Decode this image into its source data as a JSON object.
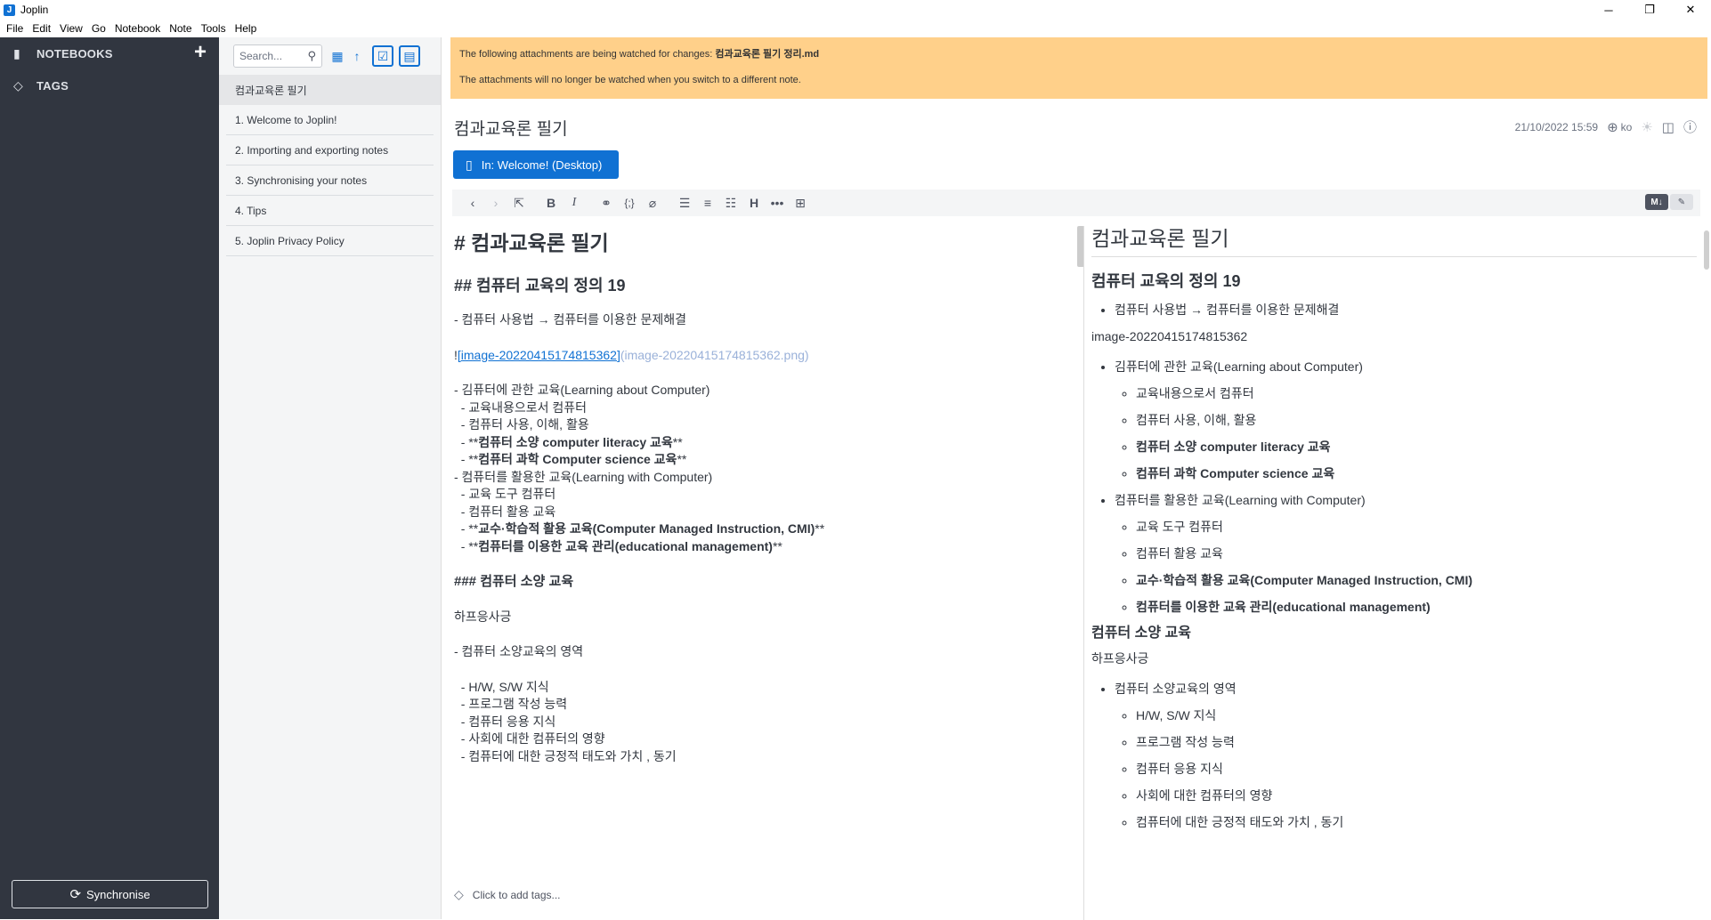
{
  "window": {
    "title": "Joplin",
    "minimize": "─",
    "maximize": "❐",
    "close": "✕"
  },
  "menu": [
    "File",
    "Edit",
    "View",
    "Go",
    "Notebook",
    "Note",
    "Tools",
    "Help"
  ],
  "sidebar": {
    "notebooks_label": "NOTEBOOKS",
    "tags_label": "TAGS",
    "add_icon": "+",
    "sync_label": "Synchronise"
  },
  "notelist": {
    "search_placeholder": "Search...",
    "notes": [
      "컴과교육론 필기",
      "1. Welcome to Joplin!",
      "2. Importing and exporting notes",
      "3. Synchronising your notes",
      "4. Tips",
      "5. Joplin Privacy Policy"
    ]
  },
  "banner": {
    "line1_prefix": "The following attachments are being watched for changes: ",
    "line1_file": "컴과교육론 필기 정리.md",
    "line2": "The attachments will no longer be watched when you switch to a different note."
  },
  "note": {
    "title": "컴과교육론 필기",
    "date": "21/10/2022 15:59",
    "lang": "ko",
    "notebook_button": "In: Welcome! (Desktop)",
    "tags_placeholder": "Click to add tags..."
  },
  "toggle": {
    "md": "M↓",
    "edit": "✎"
  },
  "markdown": {
    "h1": "# 컴과교육론 필기",
    "h2": "## 컴퓨터 교육의 정의 19",
    "l1": "- 컴퓨터 사용법 → 컴퓨터를 이용한 문제해결",
    "img_bang": "!",
    "img_text": "[image-20220415174815362]",
    "img_url": "(image-20220415174815362.png)",
    "l2": "- 김퓨터에 관한 교육(Learning about Computer)",
    "l3": "  - 교육내용으로서 컴퓨터",
    "l4": "  - 컴퓨터 사용, 이해, 활용",
    "l5_pre": "  - **",
    "l5_bold": "컴퓨터 소양 computer literacy 교육",
    "l5_post": "**",
    "l6_pre": "  - **",
    "l6_bold": "컴퓨터 과학 Computer science 교육",
    "l6_post": "**",
    "l7": "- 컴퓨터를 활용한 교육(Learning with Computer)",
    "l8": "  - 교육 도구 컴퓨터",
    "l9": "  - 컴퓨터 활용 교육",
    "l10_pre": "  - **",
    "l10_bold": "교수·학습적 활용 교육(Computer Managed Instruction, CMI)",
    "l10_post": "**",
    "l11_pre": "  - **",
    "l11_bold": "컴퓨터를 이용한 교육 관리(educational management)",
    "l11_post": "**",
    "h3": "### 컴퓨터 소양 교육",
    "p1": "하프응사긍",
    "l12": "- 컴퓨터 소양교육의 영역",
    "l13": "  - H/W, S/W 지식",
    "l14": "  - 프로그램 작성 능력",
    "l15": "  - 컴퓨터 응용 지식",
    "l16": "  - 사회에 대한 컴퓨터의 영향",
    "l17": "  - 컴퓨터에 대한 긍정적 태도와 가치 , 동기"
  },
  "viewer": {
    "h1": "컴과교육론 필기",
    "h2": "컴퓨터 교육의 정의 19",
    "b1": "컴퓨터 사용법 → 컴퓨터를 이용한 문제해결",
    "img_alt": "image-20220415174815362",
    "b2": "김퓨터에 관한 교육(Learning about Computer)",
    "b2_1": "교육내용으로서 컴퓨터",
    "b2_2": "컴퓨터 사용, 이해, 활용",
    "b2_3": "컴퓨터 소양 computer literacy 교육",
    "b2_4": "컴퓨터 과학 Computer science 교육",
    "b3": "컴퓨터를 활용한 교육(Learning with Computer)",
    "b3_1": "교육 도구 컴퓨터",
    "b3_2": "컴퓨터 활용 교육",
    "b3_3": "교수·학습적 활용 교육(Computer Managed Instruction, CMI)",
    "b3_4": "컴퓨터를 이용한 교육 관리(educational management)",
    "h3": "컴퓨터 소양 교육",
    "p1": "하프응사긍",
    "b4": "컴퓨터 소양교육의 영역",
    "b4_1": "H/W, S/W 지식",
    "b4_2": "프로그램 작성 능력",
    "b4_3": "컴퓨터 응용 지식",
    "b4_4": "사회에 대한 컴퓨터의 영향",
    "b4_5": "컴퓨터에 대한 긍정적 태도와 가치 , 동기"
  }
}
